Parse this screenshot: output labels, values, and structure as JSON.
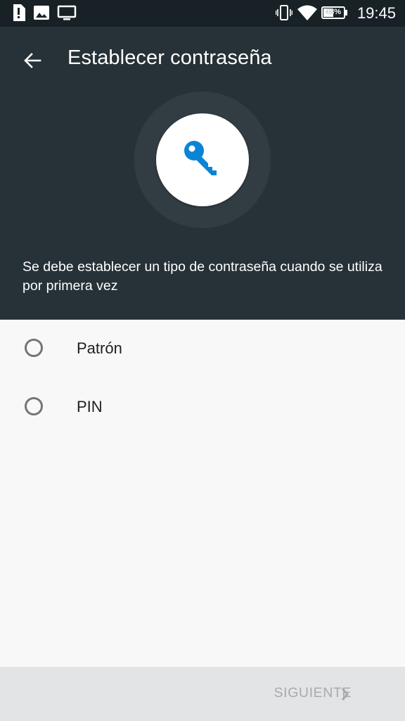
{
  "status_bar": {
    "time": "19:45",
    "battery_percent": "48%",
    "icons": [
      "alert-notification-icon",
      "image-notification-icon",
      "cast-screen-icon",
      "vibrate-icon",
      "wifi-icon",
      "battery-icon"
    ]
  },
  "header": {
    "title": "Establecer contraseña",
    "description": "Se debe establecer un tipo de contraseña cuando se utiliza por primera vez",
    "key_icon_color": "#0a85d6"
  },
  "options": [
    {
      "label": "Patrón",
      "selected": false
    },
    {
      "label": "PIN",
      "selected": false
    }
  ],
  "footer": {
    "next_label": "SIGUIENTE"
  },
  "colors": {
    "status_bar": "#182126",
    "header": "#263238",
    "accent": "#0a85d6",
    "disabled_text": "#a8aaac"
  }
}
